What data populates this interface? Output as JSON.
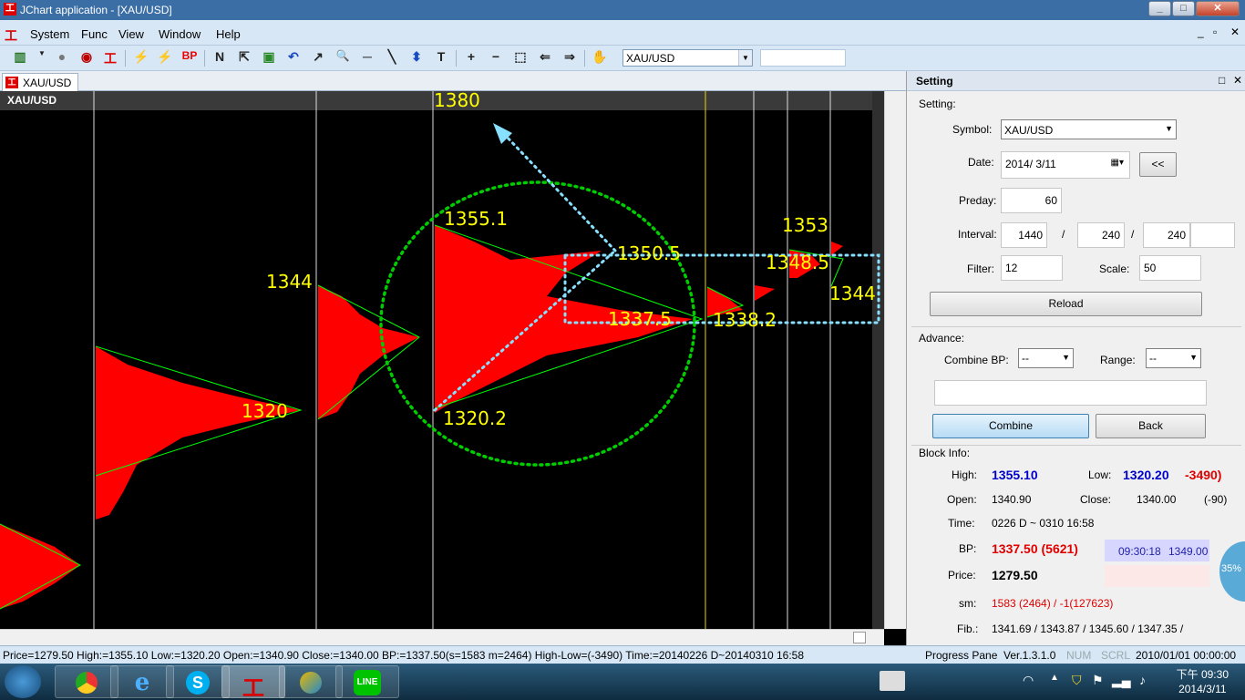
{
  "window": {
    "title": "JChart application - [XAU/USD]",
    "min": "_",
    "max": "□",
    "close": "✕"
  },
  "menu": [
    "System",
    "Func",
    "View",
    "Window",
    "Help"
  ],
  "toolbar": {
    "symbol_value": "XAU/USD",
    "icons": [
      "bar-chart-icon",
      "circle-icon",
      "car-icon",
      "logo-icon",
      "lightning-yellow-icon",
      "lightning-red-icon",
      "bp-icon",
      "n-icon",
      "cursor-icon",
      "cube-icon",
      "undo-icon",
      "step-icon",
      "zoom-icon",
      "hline-icon",
      "diag-line-icon",
      "arrow-updown-icon",
      "text-icon",
      "plus-icon",
      "minus-icon",
      "select-box-icon",
      "left-icon",
      "right-icon",
      "hand-icon"
    ],
    "glyphs": [
      "▥",
      "●",
      "◉",
      "工",
      "⚡",
      "⚡",
      "BP",
      "N",
      "⇱",
      "▣",
      "↶",
      "↗",
      "🔍",
      "─",
      "╲",
      "⬍",
      "T",
      "+",
      "−",
      "⬚",
      "⇐",
      "⇒",
      "✋"
    ]
  },
  "tab": {
    "label": "XAU/USD"
  },
  "chart": {
    "corner_label": "XAU/USD",
    "annotations": [
      {
        "id": "ann-1380",
        "text": "1380"
      },
      {
        "id": "ann-1355",
        "text": "1355.1"
      },
      {
        "id": "ann-1350",
        "text": "1350.5"
      },
      {
        "id": "ann-1353",
        "text": "1353"
      },
      {
        "id": "ann-1348",
        "text": "1348.5"
      },
      {
        "id": "ann-1344a",
        "text": "1344"
      },
      {
        "id": "ann-1344b",
        "text": "1344"
      },
      {
        "id": "ann-1337",
        "text": "1337.5"
      },
      {
        "id": "ann-1338",
        "text": "1338.2"
      },
      {
        "id": "ann-1320",
        "text": "1320"
      },
      {
        "id": "ann-1320b",
        "text": "1320.2"
      }
    ]
  },
  "settings": {
    "title": "Setting",
    "section": "Setting:",
    "symbol_label": "Symbol:",
    "symbol_value": "XAU/USD",
    "date_label": "Date:",
    "date_value": "2014/  3/11",
    "date_back": "<<",
    "preday_label": "Preday:",
    "preday_value": "60",
    "interval_label": "Interval:",
    "interval_values": [
      "1440",
      "240",
      "240",
      ""
    ],
    "interval_sep": "/",
    "filter_label": "Filter:",
    "filter_value": "12",
    "scale_label": "Scale:",
    "scale_value": "50",
    "reload": "Reload",
    "advance_label": "Advance:",
    "combine_bp_label": "Combine BP:",
    "combine_bp_value": "--",
    "range_label": "Range:",
    "range_value": "--",
    "combine_button": "Combine",
    "back_button": "Back",
    "block_info_label": "Block Info:",
    "high_label": "High:",
    "high_value": "1355.10",
    "low_label": "Low:",
    "low_value": "1320.20",
    "low_diff": "-3490)",
    "open_label": "Open:",
    "open_value": "1340.90",
    "close_label": "Close:",
    "close_value": "1340.00",
    "close_diff": "(-90)",
    "time_label": "Time:",
    "time_value": "0226 D ~ 0310 16:58",
    "bp_label": "BP:",
    "bp_value": "1337.50 (5621)",
    "bp_time": "09:30:18",
    "bp_price": "1349.00",
    "price_label": "Price:",
    "price_value": "1279.50",
    "sm_label": "sm:",
    "sm_value": "1583 (2464) / -1(127623)",
    "fib_label": "Fib.:",
    "fib_value": "1341.69 / 1343.87 / 1345.60 / 1347.35 /"
  },
  "status": {
    "left": "Price=1279.50  High:=1355.10  Low:=1320.20  Open:=1340.90  Close:=1340.00  BP:=1337.50(s=1583 m=2464)  High-Low=(-3490)  Time:=20140226 D~20140310 16:58",
    "progress": "Progress Pane",
    "version": "Ver.1.3.1.0",
    "num": "NUM",
    "scrl": "SCRL",
    "datetime": "2010/01/01 00:00:00"
  },
  "taskbar": {
    "clock_ampm": "下午 09:30",
    "clock_date": "2014/3/11",
    "bubble": "35%"
  },
  "colors": {
    "chart_bg": "#000000",
    "profile": "#ff0000",
    "annotation": "#ffff00",
    "trend": "#00ff00",
    "dotted_circle": "#00cc00",
    "dotted_cyan": "#88e0ff"
  }
}
